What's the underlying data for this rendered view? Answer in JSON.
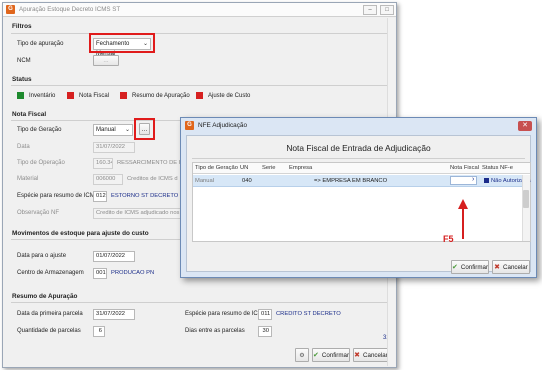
{
  "main_window": {
    "app_icon_letter": "G",
    "title": "Apuração Estoque Decreto ICMS ST",
    "filtros": {
      "section": "Filtros",
      "tipo_label": "Tipo de apuração",
      "tipo_value": "Fechamento Mensal",
      "ncm_label": "NCM",
      "ncm_button": "..."
    },
    "status": {
      "section": "Status",
      "legend": [
        {
          "label": "Inventário",
          "color": "#1e8a2e"
        },
        {
          "label": "Nota Fiscal",
          "color": "#d62020"
        },
        {
          "label": "Resumo de Apuração",
          "color": "#d62020"
        },
        {
          "label": "Ajuste de Custo",
          "color": "#d62020"
        }
      ]
    },
    "nota_fiscal": {
      "section": "Nota Fiscal",
      "tipo_geracao_label": "Tipo de Geração",
      "tipo_geracao_value": "Manual",
      "data_label": "Data",
      "data_value": "31/07/2022",
      "tipo_operacao_label": "Tipo de Operação",
      "tipo_operacao_code": "160.34",
      "tipo_operacao_desc": "RESSARCIMENTO DE ICMS I",
      "material_label": "Material",
      "material_code": "006000",
      "material_desc": "Creditos de ICMS d",
      "especie_label": "Espécie para resumo de ICMS",
      "especie_code": "012",
      "especie_desc": "ESTORNO ST DECRETO",
      "observacao_label": "Observação NF",
      "observacao_value": "Credito de ICMS adjudicado nos termos"
    },
    "movimentos": {
      "section": "Movimentos de estoque para ajuste do custo",
      "data_ajuste_label": "Data para o ajuste",
      "data_ajuste_value": "01/07/2022",
      "centro_label": "Centro de Armazenagem",
      "centro_code": "001",
      "centro_desc": "PRODUCAO PN"
    },
    "resumo": {
      "section": "Resumo de Apuração",
      "data_primeira_label": "Data da primeira parcela",
      "data_primeira_value": "31/07/2022",
      "especie_label": "Espécie para resumo de ICMS",
      "especie_code": "011",
      "especie_desc": "CREDITO ST DECRETO",
      "qtd_parcelas_label": "Quantidade de parcelas",
      "qtd_parcelas_value": "6",
      "dias_label": "Dias entre as parcelas",
      "dias_value": "30"
    },
    "side_link": "320",
    "buttons": {
      "confirm": "Confirmar",
      "cancel": "Cancelar"
    }
  },
  "dialog": {
    "app_icon_letter": "G",
    "title": "NFE Adjudicação",
    "header": "Nota Fiscal de Entrada de Adjudicação",
    "columns": [
      "Tipo de Geração",
      "UN",
      "Serie",
      "Empresa",
      "Nota Fiscal",
      "Status NF-e"
    ],
    "rows": [
      {
        "tipo": "Manual",
        "un": "040",
        "serie": "",
        "empresa": "=> EMPRESA EM BRANCO",
        "nota_fiscal": "",
        "status": "Não Autorizada"
      }
    ],
    "annotation": "F5",
    "buttons": {
      "confirm": "Confirmar",
      "cancel": "Cancelar"
    }
  }
}
